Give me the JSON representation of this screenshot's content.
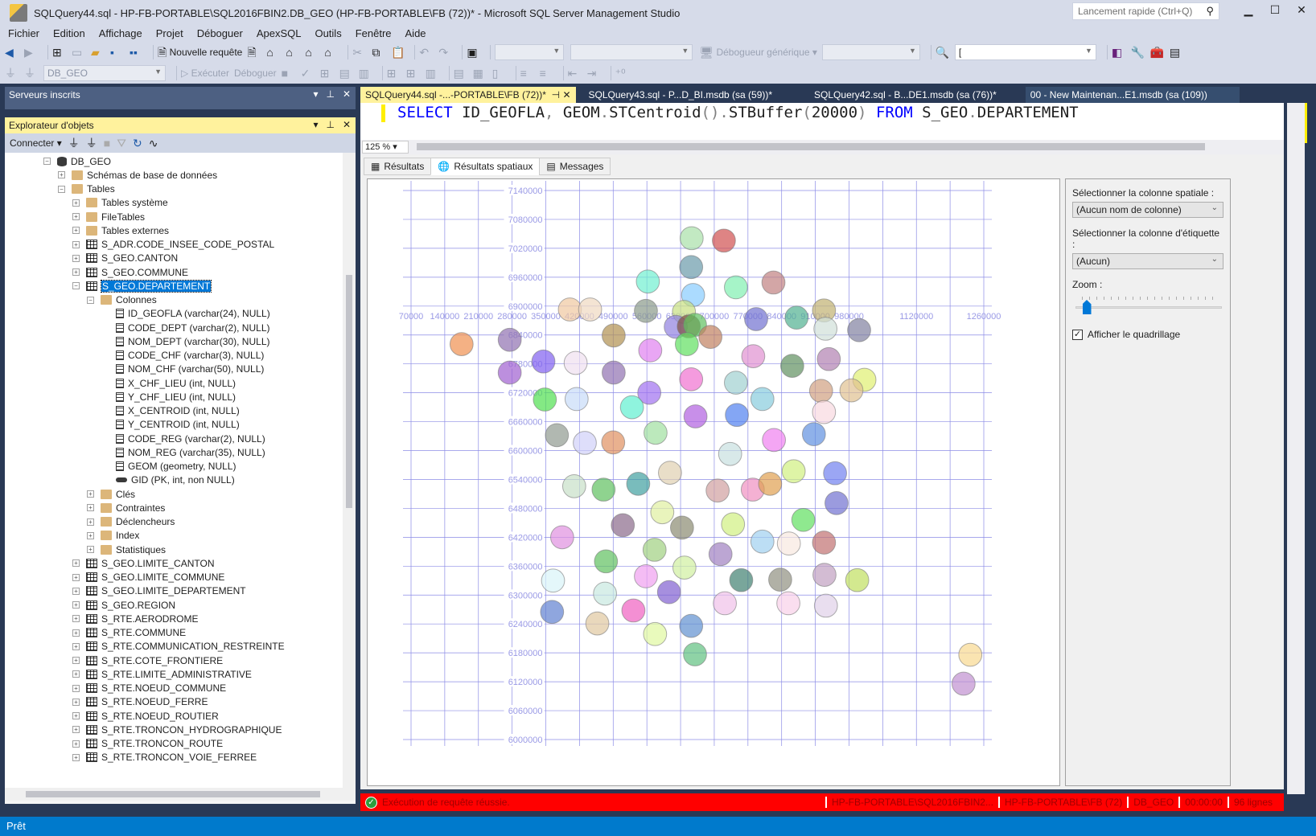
{
  "window": {
    "title": "SQLQuery44.sql - HP-FB-PORTABLE\\SQL2016FBIN2.DB_GEO (HP-FB-PORTABLE\\FB (72))* - Microsoft SQL Server Management Studio",
    "quick_launch_placeholder": "Lancement rapide (Ctrl+Q)",
    "minimize": "▁",
    "maximize": "☐",
    "close": "✕"
  },
  "menu": [
    "Fichier",
    "Edition",
    "Affichage",
    "Projet",
    "Déboguer",
    "ApexSQL",
    "Outils",
    "Fenêtre",
    "Aide"
  ],
  "toolbar1": {
    "new_query": "Nouvelle requête",
    "debugger_label": "Débogueur générique",
    "find_value": "["
  },
  "toolbar2": {
    "database": "DB_GEO",
    "execute": "Exécuter",
    "debug": "Déboguer"
  },
  "servers_panel": {
    "title": "Serveurs inscrits"
  },
  "explorer": {
    "title": "Explorateur d'objets",
    "connect": "Connecter",
    "tree": [
      {
        "level": 0,
        "exp": "-",
        "icon": "db",
        "label": "DB_GEO"
      },
      {
        "level": 1,
        "exp": "+",
        "icon": "folder",
        "label": "Schémas de base de données"
      },
      {
        "level": 1,
        "exp": "-",
        "icon": "folder",
        "label": "Tables"
      },
      {
        "level": 2,
        "exp": "+",
        "icon": "folder",
        "label": "Tables système"
      },
      {
        "level": 2,
        "exp": "+",
        "icon": "folder",
        "label": "FileTables"
      },
      {
        "level": 2,
        "exp": "+",
        "icon": "folder",
        "label": "Tables externes"
      },
      {
        "level": 2,
        "exp": "+",
        "icon": "table",
        "label": "S_ADR.CODE_INSEE_CODE_POSTAL"
      },
      {
        "level": 2,
        "exp": "+",
        "icon": "table",
        "label": "S_GEO.CANTON"
      },
      {
        "level": 2,
        "exp": "+",
        "icon": "table",
        "label": "S_GEO.COMMUNE"
      },
      {
        "level": 2,
        "exp": "-",
        "icon": "table",
        "label": "S_GEO.DEPARTEMENT",
        "selected": true
      },
      {
        "level": 3,
        "exp": "-",
        "icon": "folder",
        "label": "Colonnes"
      },
      {
        "level": 4,
        "exp": "",
        "icon": "col",
        "label": "ID_GEOFLA (varchar(24), NULL)"
      },
      {
        "level": 4,
        "exp": "",
        "icon": "col",
        "label": "CODE_DEPT (varchar(2), NULL)"
      },
      {
        "level": 4,
        "exp": "",
        "icon": "col",
        "label": "NOM_DEPT (varchar(30), NULL)"
      },
      {
        "level": 4,
        "exp": "",
        "icon": "col",
        "label": "CODE_CHF (varchar(3), NULL)"
      },
      {
        "level": 4,
        "exp": "",
        "icon": "col",
        "label": "NOM_CHF (varchar(50), NULL)"
      },
      {
        "level": 4,
        "exp": "",
        "icon": "col",
        "label": "X_CHF_LIEU (int, NULL)"
      },
      {
        "level": 4,
        "exp": "",
        "icon": "col",
        "label": "Y_CHF_LIEU (int, NULL)"
      },
      {
        "level": 4,
        "exp": "",
        "icon": "col",
        "label": "X_CENTROID (int, NULL)"
      },
      {
        "level": 4,
        "exp": "",
        "icon": "col",
        "label": "Y_CENTROID (int, NULL)"
      },
      {
        "level": 4,
        "exp": "",
        "icon": "col",
        "label": "CODE_REG (varchar(2), NULL)"
      },
      {
        "level": 4,
        "exp": "",
        "icon": "col",
        "label": "NOM_REG (varchar(35), NULL)"
      },
      {
        "level": 4,
        "exp": "",
        "icon": "col",
        "label": "GEOM (geometry, NULL)"
      },
      {
        "level": 4,
        "exp": "",
        "icon": "key",
        "label": "GID (PK, int, non NULL)"
      },
      {
        "level": 3,
        "exp": "+",
        "icon": "folder",
        "label": "Clés"
      },
      {
        "level": 3,
        "exp": "+",
        "icon": "folder",
        "label": "Contraintes"
      },
      {
        "level": 3,
        "exp": "+",
        "icon": "folder",
        "label": "Déclencheurs"
      },
      {
        "level": 3,
        "exp": "+",
        "icon": "folder",
        "label": "Index"
      },
      {
        "level": 3,
        "exp": "+",
        "icon": "folder",
        "label": "Statistiques"
      },
      {
        "level": 2,
        "exp": "+",
        "icon": "table",
        "label": "S_GEO.LIMITE_CANTON"
      },
      {
        "level": 2,
        "exp": "+",
        "icon": "table",
        "label": "S_GEO.LIMITE_COMMUNE"
      },
      {
        "level": 2,
        "exp": "+",
        "icon": "table",
        "label": "S_GEO.LIMITE_DEPARTEMENT"
      },
      {
        "level": 2,
        "exp": "+",
        "icon": "table",
        "label": "S_GEO.REGION"
      },
      {
        "level": 2,
        "exp": "+",
        "icon": "table",
        "label": "S_RTE.AERODROME"
      },
      {
        "level": 2,
        "exp": "+",
        "icon": "table",
        "label": "S_RTE.COMMUNE"
      },
      {
        "level": 2,
        "exp": "+",
        "icon": "table",
        "label": "S_RTE.COMMUNICATION_RESTREINTE"
      },
      {
        "level": 2,
        "exp": "+",
        "icon": "table",
        "label": "S_RTE.COTE_FRONTIERE"
      },
      {
        "level": 2,
        "exp": "+",
        "icon": "table",
        "label": "S_RTE.LIMITE_ADMINISTRATIVE"
      },
      {
        "level": 2,
        "exp": "+",
        "icon": "table",
        "label": "S_RTE.NOEUD_COMMUNE"
      },
      {
        "level": 2,
        "exp": "+",
        "icon": "table",
        "label": "S_RTE.NOEUD_FERRE"
      },
      {
        "level": 2,
        "exp": "+",
        "icon": "table",
        "label": "S_RTE.NOEUD_ROUTIER"
      },
      {
        "level": 2,
        "exp": "+",
        "icon": "table",
        "label": "S_RTE.TRONCON_HYDROGRAPHIQUE"
      },
      {
        "level": 2,
        "exp": "+",
        "icon": "table",
        "label": "S_RTE.TRONCON_ROUTE"
      },
      {
        "level": 2,
        "exp": "+",
        "icon": "table",
        "label": "S_RTE.TRONCON_VOIE_FERREE"
      }
    ]
  },
  "doc_tabs": [
    {
      "label": "SQLQuery44.sql -...-PORTABLE\\FB (72))*",
      "active": true
    },
    {
      "label": "SQLQuery43.sql - P...D_BI.msdb (sa (59))*",
      "active": false
    },
    {
      "label": "SQLQuery42.sql - B...DE1.msdb (sa (76))*",
      "active": false
    },
    {
      "label": "00 - New Maintenan...E1.msdb (sa (109))",
      "active": false
    }
  ],
  "editor": {
    "sql": {
      "select": "SELECT",
      "rest1": " ID_GEOFLA",
      "comma": ",",
      "rest2": " GEOM",
      "dot1": ".",
      "fn1": "STCentroid",
      "paren1": "()",
      "dot2": ".",
      "fn2": "STBuffer",
      "open": "(",
      "arg": "20000",
      "close": ")",
      "from": " FROM",
      "schema": " S_GEO",
      "dot3": ".",
      "table": "DEPARTEMENT"
    },
    "zoom": "125 %"
  },
  "result_tabs": [
    {
      "label": "Résultats",
      "icon": "grid-icon",
      "active": false
    },
    {
      "label": "Résultats spatiaux",
      "icon": "globe-icon",
      "active": true
    },
    {
      "label": "Messages",
      "icon": "messages-icon",
      "active": false
    }
  ],
  "spatial_panel": {
    "spatial_column_label": "Sélectionner la colonne spatiale :",
    "spatial_column_value": "(Aucun nom de colonne)",
    "label_column_label": "Sélectionner la colonne d'étiquette :",
    "label_column_value": "(Aucun)",
    "zoom_label": "Zoom :",
    "zoom_level": 0.05,
    "show_grid_label": "Afficher le quadrillage",
    "show_grid_checked": true
  },
  "query_status": {
    "message": "Exécution de requête réussie.",
    "server": "HP-FB-PORTABLE\\SQL2016FBIN2...",
    "user": "HP-FB-PORTABLE\\FB (72)",
    "database": "DB_GEO",
    "elapsed": "00:00:00",
    "rows": "96 lignes"
  },
  "right_strip": {
    "zoom": "125 %"
  },
  "statusbar": {
    "text": "Prêt"
  },
  "chart_data": {
    "type": "scatter",
    "title": "",
    "xlabel": "",
    "ylabel": "",
    "grid": true,
    "marker": "circle buffer 20000",
    "xlim": [
      70000,
      1260000
    ],
    "ylim": [
      6000000,
      7140000
    ],
    "x_ticks": [
      70000,
      140000,
      210000,
      280000,
      350000,
      420000,
      490000,
      560000,
      630000,
      700000,
      770000,
      840000,
      910000,
      980000,
      1120000,
      1260000
    ],
    "y_ticks": [
      7140000,
      7080000,
      7020000,
      6960000,
      6900000,
      6840000,
      6780000,
      6720000,
      6660000,
      6600000,
      6540000,
      6480000,
      6420000,
      6360000,
      6300000,
      6240000,
      6180000,
      6120000,
      6060000,
      6000000
    ],
    "buffer_radius": 20000,
    "points": [
      {
        "x": 653000,
        "y": 7041000,
        "color": "#a8e0a8"
      },
      {
        "x": 720000,
        "y": 7036000,
        "color": "#d05050"
      },
      {
        "x": 652000,
        "y": 6981000,
        "color": "#6a9aaa"
      },
      {
        "x": 562000,
        "y": 6951000,
        "color": "#70f0d0"
      },
      {
        "x": 656000,
        "y": 6923000,
        "color": "#88ccff"
      },
      {
        "x": 745000,
        "y": 6939000,
        "color": "#80f0b0"
      },
      {
        "x": 823000,
        "y": 6949000,
        "color": "#c08080"
      },
      {
        "x": 400000,
        "y": 6893000,
        "color": "#f0c8a0"
      },
      {
        "x": 442000,
        "y": 6893000,
        "color": "#f0d8c0"
      },
      {
        "x": 558000,
        "y": 6890000,
        "color": "#8a9a8a"
      },
      {
        "x": 637000,
        "y": 6888000,
        "color": "#c8e080"
      },
      {
        "x": 928000,
        "y": 6891000,
        "color": "#c0b070"
      },
      {
        "x": 871000,
        "y": 6876000,
        "color": "#50b090"
      },
      {
        "x": 787000,
        "y": 6873000,
        "color": "#7070d0"
      },
      {
        "x": 620000,
        "y": 6857000,
        "color": "#9080e0"
      },
      {
        "x": 647000,
        "y": 6858000,
        "color": "#805040"
      },
      {
        "x": 660000,
        "y": 6861000,
        "color": "#60c060"
      },
      {
        "x": 931000,
        "y": 6853000,
        "color": "#d0e0d8"
      },
      {
        "x": 1001000,
        "y": 6850000,
        "color": "#8080a0"
      },
      {
        "x": 175000,
        "y": 6821000,
        "color": "#f09050"
      },
      {
        "x": 275000,
        "y": 6830000,
        "color": "#9070b0"
      },
      {
        "x": 491000,
        "y": 6839000,
        "color": "#b09050"
      },
      {
        "x": 643000,
        "y": 6821000,
        "color": "#60e060"
      },
      {
        "x": 692000,
        "y": 6836000,
        "color": "#c08060"
      },
      {
        "x": 567000,
        "y": 6808000,
        "color": "#e080f0"
      },
      {
        "x": 345000,
        "y": 6785000,
        "color": "#8060f0"
      },
      {
        "x": 412000,
        "y": 6782000,
        "color": "#f0e0f0"
      },
      {
        "x": 491000,
        "y": 6762000,
        "color": "#9070b0"
      },
      {
        "x": 275000,
        "y": 6762000,
        "color": "#a060d0"
      },
      {
        "x": 781000,
        "y": 6796000,
        "color": "#e090d0"
      },
      {
        "x": 862000,
        "y": 6776000,
        "color": "#609060"
      },
      {
        "x": 938000,
        "y": 6790000,
        "color": "#b080b0"
      },
      {
        "x": 652000,
        "y": 6748000,
        "color": "#f070d0"
      },
      {
        "x": 745000,
        "y": 6741000,
        "color": "#a0d0d0"
      },
      {
        "x": 1012000,
        "y": 6747000,
        "color": "#e0f070"
      },
      {
        "x": 922000,
        "y": 6724000,
        "color": "#d0a080"
      },
      {
        "x": 985000,
        "y": 6725000,
        "color": "#e0c090"
      },
      {
        "x": 565000,
        "y": 6720000,
        "color": "#a070f0"
      },
      {
        "x": 348000,
        "y": 6706000,
        "color": "#50e050"
      },
      {
        "x": 414000,
        "y": 6707000,
        "color": "#c8dcf8"
      },
      {
        "x": 800000,
        "y": 6707000,
        "color": "#88ccdd"
      },
      {
        "x": 529000,
        "y": 6690000,
        "color": "#60f0d0"
      },
      {
        "x": 661000,
        "y": 6671000,
        "color": "#b060e0"
      },
      {
        "x": 747000,
        "y": 6674000,
        "color": "#5080f0"
      },
      {
        "x": 928000,
        "y": 6680000,
        "color": "#f8d8e0"
      },
      {
        "x": 373000,
        "y": 6632000,
        "color": "#909a90"
      },
      {
        "x": 431000,
        "y": 6616000,
        "color": "#d0d0f8"
      },
      {
        "x": 490000,
        "y": 6617000,
        "color": "#e09060"
      },
      {
        "x": 578000,
        "y": 6637000,
        "color": "#a0e0a0"
      },
      {
        "x": 824000,
        "y": 6622000,
        "color": "#f080f0"
      },
      {
        "x": 907000,
        "y": 6634000,
        "color": "#6090e0"
      },
      {
        "x": 733000,
        "y": 6593000,
        "color": "#c8e0e0"
      },
      {
        "x": 409000,
        "y": 6526000,
        "color": "#c8e0c8"
      },
      {
        "x": 470000,
        "y": 6519000,
        "color": "#60c060"
      },
      {
        "x": 542000,
        "y": 6531000,
        "color": "#40a0a0"
      },
      {
        "x": 608000,
        "y": 6554000,
        "color": "#e0d0b0"
      },
      {
        "x": 707000,
        "y": 6517000,
        "color": "#d0a0a0"
      },
      {
        "x": 780000,
        "y": 6519000,
        "color": "#f090c0"
      },
      {
        "x": 816000,
        "y": 6531000,
        "color": "#e0a050"
      },
      {
        "x": 865000,
        "y": 6557000,
        "color": "#d0f080"
      },
      {
        "x": 951000,
        "y": 6553000,
        "color": "#7080f0"
      },
      {
        "x": 592000,
        "y": 6472000,
        "color": "#e0f0a0"
      },
      {
        "x": 954000,
        "y": 6491000,
        "color": "#7070d0"
      },
      {
        "x": 885000,
        "y": 6456000,
        "color": "#60e060"
      },
      {
        "x": 384000,
        "y": 6420000,
        "color": "#e090e0"
      },
      {
        "x": 510000,
        "y": 6445000,
        "color": "#8a6a8a"
      },
      {
        "x": 633000,
        "y": 6440000,
        "color": "#8a8a70"
      },
      {
        "x": 739000,
        "y": 6447000,
        "color": "#d0f080"
      },
      {
        "x": 800000,
        "y": 6411000,
        "color": "#a0d0f0"
      },
      {
        "x": 855000,
        "y": 6407000,
        "color": "#f8e8e0"
      },
      {
        "x": 928000,
        "y": 6409000,
        "color": "#c07070"
      },
      {
        "x": 576000,
        "y": 6394000,
        "color": "#a0d080"
      },
      {
        "x": 713000,
        "y": 6385000,
        "color": "#a080c0"
      },
      {
        "x": 475000,
        "y": 6370000,
        "color": "#60c060"
      },
      {
        "x": 638000,
        "y": 6357000,
        "color": "#d0f0a0"
      },
      {
        "x": 558000,
        "y": 6339000,
        "color": "#f0a0f0"
      },
      {
        "x": 929000,
        "y": 6342000,
        "color": "#c0a0c0"
      },
      {
        "x": 365000,
        "y": 6330000,
        "color": "#d8f4f8"
      },
      {
        "x": 756000,
        "y": 6331000,
        "color": "#408070"
      },
      {
        "x": 837000,
        "y": 6332000,
        "color": "#909080"
      },
      {
        "x": 997000,
        "y": 6331000,
        "color": "#c0e060"
      },
      {
        "x": 473000,
        "y": 6303000,
        "color": "#c8e8e0"
      },
      {
        "x": 606000,
        "y": 6306000,
        "color": "#8060d0"
      },
      {
        "x": 722000,
        "y": 6283000,
        "color": "#f0c0e8"
      },
      {
        "x": 854000,
        "y": 6283000,
        "color": "#f8d0e8"
      },
      {
        "x": 932000,
        "y": 6278000,
        "color": "#e0d0e8"
      },
      {
        "x": 532000,
        "y": 6268000,
        "color": "#f060c0"
      },
      {
        "x": 363000,
        "y": 6265000,
        "color": "#6080d0"
      },
      {
        "x": 457000,
        "y": 6241000,
        "color": "#e0c8a0"
      },
      {
        "x": 577000,
        "y": 6219000,
        "color": "#e0f8a0"
      },
      {
        "x": 652000,
        "y": 6236000,
        "color": "#6090d0"
      },
      {
        "x": 660000,
        "y": 6177000,
        "color": "#60c080"
      },
      {
        "x": 1232000,
        "y": 6176000,
        "color": "#f8d890"
      },
      {
        "x": 1218000,
        "y": 6116000,
        "color": "#c090d0"
      }
    ]
  }
}
